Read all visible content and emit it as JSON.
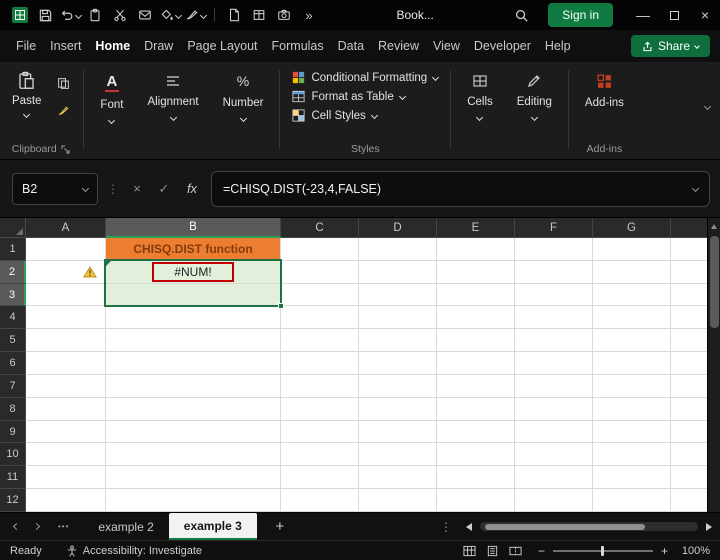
{
  "titlebar": {
    "workbook_name": "Book...",
    "signin_label": "Sign in",
    "more_commands": "»",
    "minimize": "—",
    "close": "×"
  },
  "menubar": {
    "items": [
      "File",
      "Insert",
      "Home",
      "Draw",
      "Page Layout",
      "Formulas",
      "Data",
      "Review",
      "View",
      "Developer",
      "Help"
    ],
    "active_tab": "Home",
    "share_label": "Share"
  },
  "ribbon": {
    "paste_label": "Paste",
    "font_label": "Font",
    "alignment_label": "Alignment",
    "number_label": "Number",
    "styles_items": [
      "Conditional Formatting",
      "Format as Table",
      "Cell Styles"
    ],
    "cells_label": "Cells",
    "editing_label": "Editing",
    "addins_label": "Add-ins",
    "group_labels": {
      "clipboard": "Clipboard",
      "styles": "Styles",
      "addins": "Add-ins"
    },
    "font_icon_letter": "A",
    "number_icon_glyph": "%"
  },
  "formula_bar": {
    "name_box_value": "B2",
    "cancel_glyph": "×",
    "enter_glyph": "✓",
    "fx_label": "fx",
    "formula": "=CHISQ.DIST(-23,4,FALSE)"
  },
  "grid": {
    "columns": [
      "A",
      "B",
      "C",
      "D",
      "E",
      "F",
      "G"
    ],
    "rows": [
      "1",
      "2",
      "3",
      "4",
      "5",
      "6",
      "7",
      "8",
      "9",
      "10",
      "11",
      "12"
    ],
    "selected_column": "B",
    "selected_rows": [
      "2",
      "3"
    ],
    "active_cell": "B2",
    "cells": {
      "B1": {
        "text": "CHISQ.DIST function",
        "bg": "#ED7D31",
        "color": "#843C0C",
        "bold": true,
        "align": "center"
      },
      "A2": {
        "warning": true
      },
      "B2": {
        "text": "#NUM!",
        "bg": "#E2EFDA",
        "color": "#1f1f1f",
        "align": "center",
        "red_box": true,
        "error_mark": true
      },
      "B3": {
        "bg": "#E2EFDA"
      }
    }
  },
  "sheet_tabs": {
    "list_dots": "•••",
    "tabs": [
      {
        "label": "example 2",
        "active": false
      },
      {
        "label": "example 3",
        "active": true
      }
    ],
    "add_label": "+",
    "options_dots": "⋮"
  },
  "status_bar": {
    "ready_label": "Ready",
    "accessibility_label": "Accessibility: Investigate",
    "zoom_out": "−",
    "zoom_in": "+",
    "zoom_level": "100%"
  },
  "colors": {
    "accent_green": "#107C41",
    "selection_border": "#1E7145",
    "error_red": "#C00000",
    "result_cell_green": "#E2EFDA",
    "title_cell_orange": "#ED7D31"
  }
}
